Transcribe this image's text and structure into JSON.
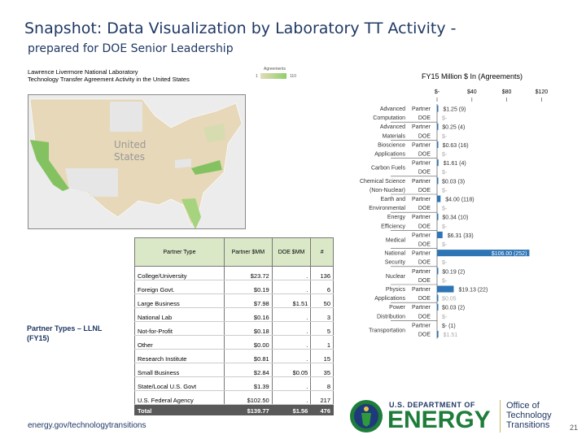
{
  "title": "Snapshot: Data Visualization by Laboratory TT Activity -",
  "subtitle": "prepared for DOE Senior Leadership",
  "map": {
    "title_line1": "Lawrence Livermore National Laboratory",
    "title_line2": "Technology Transfer Agreement Activity in the United States",
    "legend_title": "Agreements",
    "legend_min": "1",
    "legend_max": "110",
    "country_label_1": "United",
    "country_label_2": "States"
  },
  "partner_types_label": "Partner Types – LLNL (FY15)",
  "table": {
    "headers": [
      "Partner Type",
      "Partner $MM",
      "DOE $MM",
      "#"
    ],
    "rows": [
      [
        "College/University",
        "$23.72",
        ".",
        "136"
      ],
      [
        "Foreign Govt.",
        "$0.19",
        ".",
        "6"
      ],
      [
        "Large Business",
        "$7.98",
        "$1.51",
        "50"
      ],
      [
        "National Lab",
        "$0.16",
        ".",
        "3"
      ],
      [
        "Not-for-Profit",
        "$0.18",
        ".",
        "5"
      ],
      [
        "Other",
        "$0.00",
        ".",
        "1"
      ],
      [
        "Research Institute",
        "$0.81",
        ".",
        "15"
      ],
      [
        "Small Business",
        "$2.84",
        "$0.05",
        "35"
      ],
      [
        "State/Local U.S. Govt",
        "$1.39",
        ".",
        "8"
      ],
      [
        "U.S. Federal Agency",
        "$102.50",
        ".",
        "217"
      ]
    ],
    "total": [
      "Total",
      "$139.77",
      "$1.56",
      "476"
    ]
  },
  "footer": "energy.gov/technologytransitions",
  "page_number": "21",
  "logo": {
    "line1": "U.S. DEPARTMENT OF",
    "line2": "ENERGY",
    "office": [
      "Office of",
      "Technology",
      "Transitions"
    ]
  },
  "colors": {
    "bar": "#2e75b6",
    "title": "#1f3864",
    "doe_green": "#1e7d3a"
  },
  "chart_data": {
    "type": "bar",
    "orientation": "horizontal",
    "title": "FY15 Million $ In (Agreements)",
    "xticks": [
      "$-",
      "$40",
      "$80",
      "$120"
    ],
    "xlim": [
      0,
      130
    ],
    "categories": [
      "Advanced Computation",
      "Advanced Materials",
      "Bioscience Applications",
      "Carbon Fuels",
      "Chemical Science (Non-Nuclear)",
      "Earth and Environmental",
      "Energy Efficiency",
      "Medical",
      "National Security",
      "Nuclear",
      "Physics Applications",
      "Power Distribution",
      "Transportation"
    ],
    "series": [
      {
        "name": "Partner",
        "values": [
          1.25,
          0.25,
          0.63,
          1.61,
          0.03,
          4.0,
          0.34,
          6.31,
          106.0,
          0.19,
          19.13,
          0.03,
          0
        ],
        "labels": [
          "$1.25 (9)",
          "$0.25 (4)",
          "$0.63 (16)",
          "$1.61 (4)",
          "$0.03 (3)",
          "$4.00 (118)",
          "$0.34 (10)",
          "$6.31 (33)",
          "$106.00 (252)",
          "$0.19 (2)",
          "$19.13 (22)",
          "$0.03 (2)",
          "$- (1)"
        ]
      },
      {
        "name": "DOE",
        "values": [
          0,
          0,
          0,
          0,
          0,
          0,
          0,
          0,
          0,
          0,
          0.05,
          0,
          1.51
        ],
        "labels": [
          "$-",
          "$-",
          "$-",
          "$-",
          "$-",
          "$-",
          "$-",
          "$-",
          "$-",
          "$-",
          "$0.05",
          "$-",
          "$1.51"
        ]
      }
    ]
  }
}
